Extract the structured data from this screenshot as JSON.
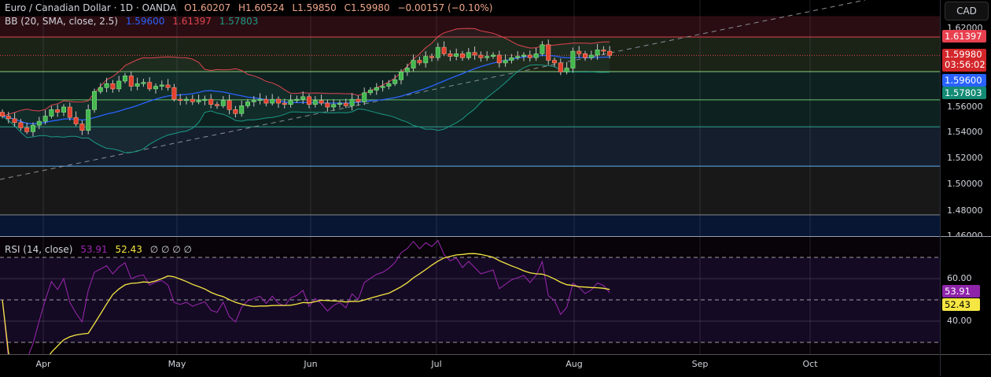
{
  "header": {
    "symbol": "Euro / Canadian Dollar · 1D · OANDA",
    "open": "O1.60207",
    "high": "H1.60524",
    "low": "L1.59850",
    "close": "C1.59980",
    "change": "−0.00157 (−0.10%)",
    "bb_label": "BB (20, SMA, close, 2.5)",
    "bb_basis": "1.59600",
    "bb_upper": "1.61397",
    "bb_lower": "1.57803"
  },
  "rsi_header": {
    "label": "RSI (14, close)",
    "rsi": "53.91",
    "ma": "52.43",
    "extras": "∅ ∅ ∅ ∅"
  },
  "axis": {
    "currency": "CAD",
    "price_ticks": [
      "1.62000",
      "1.56000",
      "1.54000",
      "1.52000",
      "1.50000",
      "1.48000",
      "1.46000"
    ],
    "badges": {
      "upper": "1.61397",
      "close": "1.59980",
      "countdown": "03:56:02",
      "basis": "1.59600",
      "lower": "1.57803"
    },
    "rsi_ticks": [
      "60.00",
      "40.00"
    ],
    "rsi_badges": {
      "rsi": "53.91",
      "ma": "52.43"
    }
  },
  "time_labels": [
    "Apr",
    "May",
    "Jun",
    "Jul",
    "Aug",
    "Sep",
    "Oct"
  ],
  "colors": {
    "bull": "#43b84f",
    "bear": "#e5402f",
    "bb_basis": "#2962ff",
    "bb_upper": "#e0444f",
    "bb_lower": "#1a9985",
    "rsi": "#9c27b0",
    "rsi_ma": "#f5e642"
  },
  "chart_data": {
    "type": "candlestick",
    "title": "Euro / Canadian Dollar · 1D · OANDA",
    "ylim": [
      1.46,
      1.62
    ],
    "closes": [
      1.553,
      1.551,
      1.548,
      1.544,
      1.541,
      1.546,
      1.549,
      1.553,
      1.558,
      1.556,
      1.56,
      1.552,
      1.547,
      1.542,
      1.558,
      1.572,
      1.575,
      1.578,
      1.574,
      1.58,
      1.584,
      1.576,
      1.578,
      1.579,
      1.574,
      1.576,
      1.577,
      1.575,
      1.566,
      1.565,
      1.566,
      1.564,
      1.565,
      1.566,
      1.562,
      1.561,
      1.565,
      1.558,
      1.555,
      1.561,
      1.564,
      1.565,
      1.566,
      1.563,
      1.566,
      1.563,
      1.562,
      1.565,
      1.566,
      1.568,
      1.562,
      1.565,
      1.563,
      1.56,
      1.562,
      1.563,
      1.561,
      1.566,
      1.564,
      1.571,
      1.573,
      1.575,
      1.576,
      1.578,
      1.581,
      1.587,
      1.59,
      1.596,
      1.594,
      1.599,
      1.598,
      1.606,
      1.601,
      1.599,
      1.601,
      1.598,
      1.602,
      1.6,
      1.598,
      1.599,
      1.6,
      1.594,
      1.596,
      1.598,
      1.599,
      1.6,
      1.598,
      1.601,
      1.608,
      1.596,
      1.594,
      1.587,
      1.59,
      1.603,
      1.601,
      1.598,
      1.6,
      1.604,
      1.603,
      1.5998
    ],
    "first_open": 1.556,
    "bollinger": {
      "period": 20,
      "mult": 2.5
    },
    "rsi": {
      "period": 14,
      "ma_period": 14,
      "levels": [
        70,
        50,
        30
      ],
      "ticks": [
        60,
        40
      ]
    },
    "levels": [
      {
        "price": 1.61397,
        "color": "#e0444f",
        "style": "solid"
      },
      {
        "price": 1.5998,
        "color": "#e0444f",
        "style": "dotted"
      },
      {
        "price": 1.5873,
        "color": "#8bd17c",
        "style": "solid"
      },
      {
        "price": 1.5655,
        "color": "#6cc56a",
        "style": "solid"
      },
      {
        "price": 1.5448,
        "color": "#2fa58f",
        "style": "solid"
      },
      {
        "price": 1.5145,
        "color": "#5fb0f0",
        "style": "solid"
      },
      {
        "price": 1.477,
        "color": "#888888",
        "style": "solid"
      }
    ],
    "bands": [
      {
        "from": 1.63,
        "to": 1.61397,
        "color": "#2a0d12"
      },
      {
        "from": 1.61397,
        "to": 1.5873,
        "color": "#1b2216"
      },
      {
        "from": 1.5873,
        "to": 1.5448,
        "color": "#0d2220"
      },
      {
        "from": 1.5448,
        "to": 1.5145,
        "color": "#141e2c"
      },
      {
        "from": 1.5145,
        "to": 1.477,
        "color": "#181818"
      },
      {
        "from": 1.477,
        "to": 1.46,
        "color": "#081634"
      }
    ]
  }
}
